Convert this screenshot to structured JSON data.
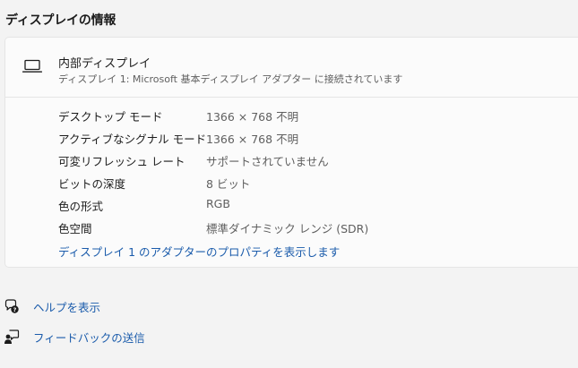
{
  "section": {
    "title": "ディスプレイの情報"
  },
  "display_card": {
    "icon": "laptop-icon",
    "name": "内部ディスプレイ",
    "subtitle": "ディスプレイ 1: Microsoft 基本ディスプレイ アダプター に接続されています",
    "rows": [
      {
        "label": "デスクトップ モード",
        "value": "1366 × 768 不明"
      },
      {
        "label": "アクティブなシグナル モード",
        "value": "1366 × 768 不明"
      },
      {
        "label": "可変リフレッシュ レート",
        "value": "サポートされていません"
      },
      {
        "label": "ビットの深度",
        "value": "8 ビット"
      },
      {
        "label": "色の形式",
        "value": "RGB"
      },
      {
        "label": "色空間",
        "value": "標準ダイナミック レンジ (SDR)"
      }
    ],
    "adapter_link": "ディスプレイ 1 のアダプターのプロパティを表示します"
  },
  "help_links": [
    {
      "icon": "help-icon",
      "label": "ヘルプを表示"
    },
    {
      "icon": "feedback-icon",
      "label": "フィードバックの送信"
    }
  ],
  "colors": {
    "link": "#1a5bab",
    "background": "#f3f3f3",
    "card": "#fbfbfb"
  }
}
